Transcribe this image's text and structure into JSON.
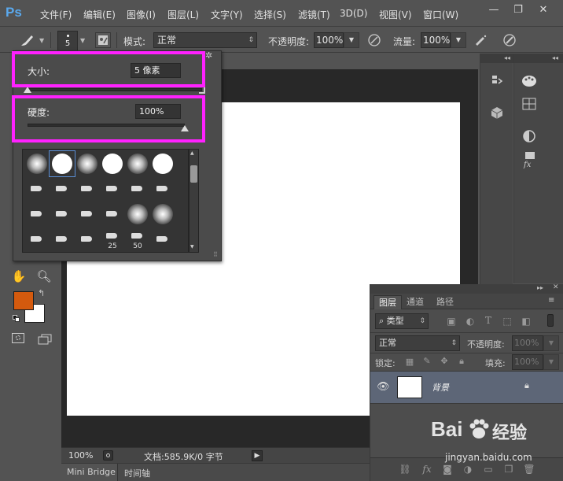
{
  "app": {
    "logo": "Ps"
  },
  "menu": [
    "文件(F)",
    "编辑(E)",
    "图像(I)",
    "图层(L)",
    "文字(Y)",
    "选择(S)",
    "滤镜(T)",
    "3D(D)",
    "视图(V)",
    "窗口(W)"
  ],
  "window_controls": {
    "minimize": "—",
    "restore": "❐",
    "close": "✕"
  },
  "options_bar": {
    "brush_size": "5",
    "mode_label": "模式:",
    "mode_value": "正常",
    "opacity_label": "不透明度:",
    "opacity_value": "100%",
    "flow_label": "流量:",
    "flow_value": "100%"
  },
  "brush_popup": {
    "size_label": "大小:",
    "size_value": "5 像素",
    "hardness_label": "硬度:",
    "hardness_value": "100%",
    "size_slider_fraction": 0.0,
    "hardness_slider_fraction": 1.0,
    "presets": [
      {
        "kind": "soft",
        "label": ""
      },
      {
        "kind": "hard-selected",
        "label": ""
      },
      {
        "kind": "soft",
        "label": ""
      },
      {
        "kind": "hard",
        "label": ""
      },
      {
        "kind": "soft",
        "label": ""
      },
      {
        "kind": "hard",
        "label": ""
      },
      {
        "kind": "tip",
        "label": ""
      },
      {
        "kind": "tip",
        "label": ""
      },
      {
        "kind": "tip",
        "label": ""
      },
      {
        "kind": "tip",
        "label": ""
      },
      {
        "kind": "tip",
        "label": ""
      },
      {
        "kind": "tip",
        "label": ""
      },
      {
        "kind": "tip",
        "label": ""
      },
      {
        "kind": "tip",
        "label": ""
      },
      {
        "kind": "tip",
        "label": ""
      },
      {
        "kind": "tip",
        "label": ""
      },
      {
        "kind": "soft",
        "label": ""
      },
      {
        "kind": "soft",
        "label": ""
      },
      {
        "kind": "tip",
        "label": ""
      },
      {
        "kind": "tip",
        "label": ""
      },
      {
        "kind": "tip",
        "label": ""
      },
      {
        "kind": "tip",
        "label": "25"
      },
      {
        "kind": "tip",
        "label": "50"
      },
      {
        "kind": "tip",
        "label": ""
      }
    ]
  },
  "colors": {
    "foreground": "#d45a0e",
    "background": "#ffffff",
    "highlight": "#ff21ff",
    "accent": "#5aa9ee"
  },
  "status": {
    "zoom": "100%",
    "doc_info": "文档:585.9K/0 字节"
  },
  "bottom_tabs": [
    "Mini Bridge",
    "时间轴"
  ],
  "layers_panel": {
    "tabs": [
      "图层",
      "通道",
      "路径"
    ],
    "filter_label": "类型",
    "blend_mode": "正常",
    "opacity_label": "不透明度:",
    "opacity_value": "100%",
    "lock_label": "锁定:",
    "fill_label": "填充:",
    "fill_value": "100%",
    "layer_name": "背景"
  },
  "watermark": {
    "brand": "Bai",
    "brand2": "经验",
    "url": "jingyan.baidu.com"
  }
}
